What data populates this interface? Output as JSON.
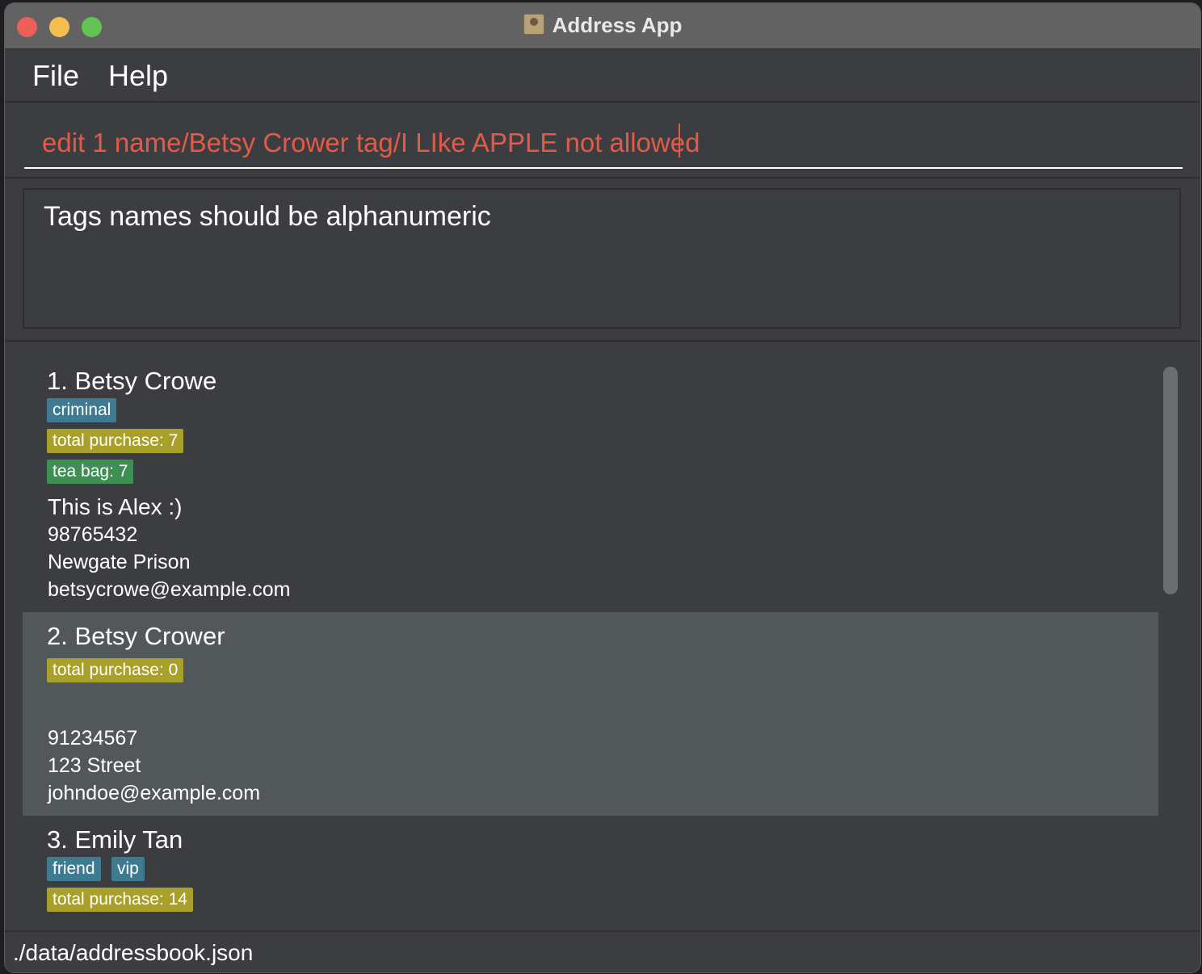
{
  "window": {
    "title": "Address App",
    "close_color": "#ed5f57",
    "minimize_color": "#f5bd4f",
    "maximize_color": "#61c454"
  },
  "menu": {
    "items": [
      "File",
      "Help"
    ]
  },
  "command": {
    "value": "edit 1 name/Betsy Crower tag/I LIke APPLE not allowed",
    "text_color": "#e25b48"
  },
  "result": {
    "message": "Tags names should be alphanumeric"
  },
  "persons": [
    {
      "index_name": "1. Betsy Crowe",
      "tags": [
        "criminal"
      ],
      "purchase": "total purchase: 7",
      "items": [
        "tea bag: 7"
      ],
      "remark": "This is Alex :)",
      "phone": "98765432",
      "address": "Newgate Prison",
      "email": "betsycrowe@example.com"
    },
    {
      "index_name": "2. Betsy Crower",
      "tags": [],
      "purchase": "total purchase: 0",
      "items": [],
      "remark": "",
      "phone": "91234567",
      "address": "123 Street",
      "email": "johndoe@example.com"
    },
    {
      "index_name": "3. Emily Tan",
      "tags": [
        "friend",
        "vip"
      ],
      "purchase": "total purchase: 14",
      "items": [],
      "remark": "",
      "phone": "",
      "address": "",
      "email": ""
    }
  ],
  "status": {
    "file_path": "./data/addressbook.json"
  },
  "colors": {
    "tag": "#3e7b91",
    "purchase": "#a8a02a",
    "item": "#3f8f54",
    "selected_card": "#525759"
  }
}
